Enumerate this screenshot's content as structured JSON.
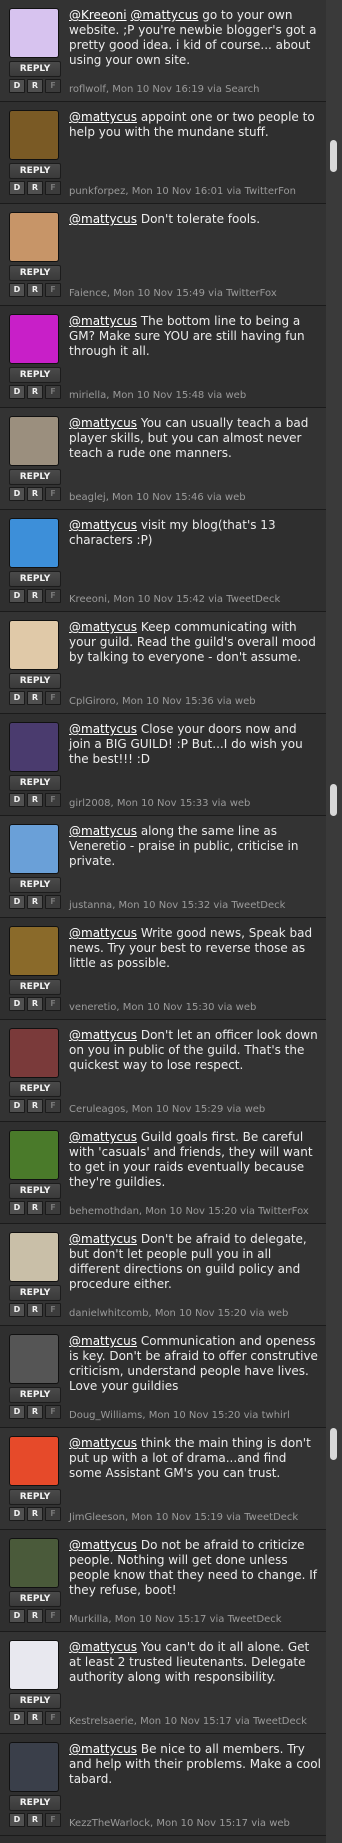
{
  "reply_label": "REPLY",
  "action_labels": {
    "dm": "D",
    "retweet": "R",
    "favorite": "F"
  },
  "tweets": [
    {
      "mentions": [
        "@Kreeoni",
        "@mattycus"
      ],
      "text": " go to your own website. ;P you're newbie blogger's got a pretty good idea. i kid of course... about using your own site.",
      "user": "roflwolf",
      "time": "Mon 10 Nov 16:19",
      "via": "via Search",
      "avatar_color": "#d7c3ef"
    },
    {
      "mentions": [
        "@mattycus"
      ],
      "text": " appoint one or two people to help you with the mundane stuff.",
      "user": "punkforpez",
      "time": "Mon 10 Nov 16:01",
      "via": "via TwitterFon",
      "avatar_color": "#7a5a25"
    },
    {
      "mentions": [
        "@mattycus"
      ],
      "text": " Don't tolerate fools.",
      "user": "Faience",
      "time": "Mon 10 Nov 15:49",
      "via": "via TwitterFox",
      "avatar_color": "#c79568"
    },
    {
      "mentions": [
        "@mattycus"
      ],
      "text": " The bottom line to being a GM? Make sure YOU are still having fun through it all.",
      "user": "miriella",
      "time": "Mon 10 Nov 15:48",
      "via": "via web",
      "avatar_color": "#c81fc8"
    },
    {
      "mentions": [
        "@mattycus"
      ],
      "text": " You can usually teach a bad player skills, but you can almost never teach a rude one manners.",
      "user": "beaglej",
      "time": "Mon 10 Nov 15:46",
      "via": "via web",
      "avatar_color": "#9b8f7e"
    },
    {
      "mentions": [
        "@mattycus"
      ],
      "text": " visit my blog(that's 13 characters :P)",
      "user": "Kreeoni",
      "time": "Mon 10 Nov 15:42",
      "via": "via TweetDeck",
      "avatar_color": "#3d8fd9"
    },
    {
      "mentions": [
        "@mattycus"
      ],
      "text": " Keep communicating with your guild. Read the guild's overall mood by talking to everyone - don't assume.",
      "user": "CplGiroro",
      "time": "Mon 10 Nov 15:36",
      "via": "via web",
      "avatar_color": "#e0c9a8"
    },
    {
      "mentions": [
        "@mattycus"
      ],
      "text": " Close your doors now and join a BIG GUILD! :P But...I do wish you the best!!! :D",
      "user": "girl2008",
      "time": "Mon 10 Nov 15:33",
      "via": "via web",
      "avatar_color": "#4a3b6e"
    },
    {
      "mentions": [
        "@mattycus"
      ],
      "text": " along the same line as Veneretio - praise in public, criticise in private.",
      "user": "justanna",
      "time": "Mon 10 Nov 15:32",
      "via": "via TweetDeck",
      "avatar_color": "#6aa0d8"
    },
    {
      "mentions": [
        "@mattycus"
      ],
      "text": " Write good news, Speak bad news. Try your best to reverse those as little as possible.",
      "user": "veneretio",
      "time": "Mon 10 Nov 15:30",
      "via": "via web",
      "avatar_color": "#8a6a2a"
    },
    {
      "mentions": [
        "@mattycus"
      ],
      "text": " Don't let an officer look down on you in public of the guild. That's the quickest way to lose respect.",
      "user": "Ceruleagos",
      "time": "Mon 10 Nov 15:29",
      "via": "via web",
      "avatar_color": "#7a3a3a"
    },
    {
      "mentions": [
        "@mattycus"
      ],
      "text": " Guild goals first. Be careful with 'casuals' and friends, they will want to get in your raids eventually because they're guildies.",
      "user": "behemothdan",
      "time": "Mon 10 Nov 15:20",
      "via": "via TwitterFox",
      "avatar_color": "#4a7a2a"
    },
    {
      "mentions": [
        "@mattycus"
      ],
      "text": " Don't be afraid to delegate, but don't let people pull you in all different directions on guild policy and procedure either.",
      "user": "danielwhitcomb",
      "time": "Mon 10 Nov 15:20",
      "via": "via web",
      "avatar_color": "#c9bfa8"
    },
    {
      "mentions": [
        "@mattycus"
      ],
      "text": " Communication and openess is key. Don't be afraid to offer construtive criticism, understand people have lives. Love your guildies",
      "user": "Doug_Williams",
      "time": "Mon 10 Nov 15:20",
      "via": "via twhirl",
      "avatar_color": "#555555"
    },
    {
      "mentions": [
        "@mattycus"
      ],
      "text": " think the main thing is don't put up with a lot of drama...and find some Assistant GM's you can trust.",
      "user": "JimGleeson",
      "time": "Mon 10 Nov 15:19",
      "via": "via TweetDeck",
      "avatar_color": "#e64a2a"
    },
    {
      "mentions": [
        "@mattycus"
      ],
      "text": " Do not be afraid to criticize people. Nothing will get done unless people know that they need to change. If they refuse, boot!",
      "user": "Murkilla",
      "time": "Mon 10 Nov 15:17",
      "via": "via TweetDeck",
      "avatar_color": "#4a5a3a"
    },
    {
      "mentions": [
        "@mattycus"
      ],
      "text": " You can't do it all alone. Get at least 2 trusted lieutenants. Delegate authority along with responsibility.",
      "user": "Kestrelsaerie",
      "time": "Mon 10 Nov 15:17",
      "via": "via TweetDeck",
      "avatar_color": "#e8e8ef"
    },
    {
      "mentions": [
        "@mattycus"
      ],
      "text": " Be nice to all members. Try and help with their problems. Make a cool tabard.",
      "user": "KezzTheWarlock",
      "time": "Mon 10 Nov 15:17",
      "via": "via web",
      "avatar_color": "#3a3f4a"
    }
  ]
}
